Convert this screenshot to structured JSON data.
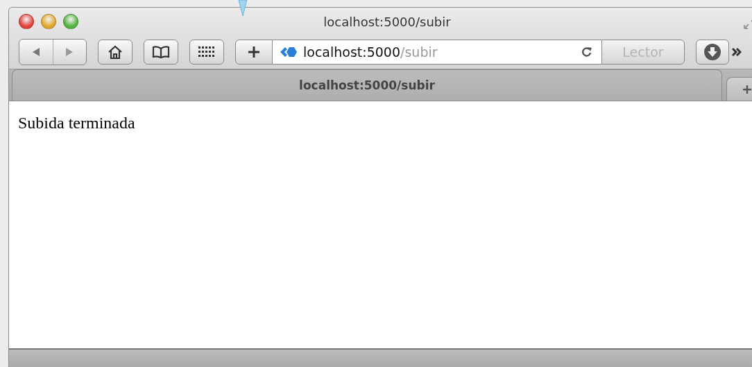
{
  "window": {
    "title": "localhost:5000/subir"
  },
  "address": {
    "host": "localhost:5000",
    "path": "/subir"
  },
  "reader_button": {
    "label": "Lector",
    "disabled": true
  },
  "tabs": [
    {
      "label": "localhost:5000/subir",
      "selected": true
    }
  ],
  "page": {
    "text": "Subida terminada"
  }
}
